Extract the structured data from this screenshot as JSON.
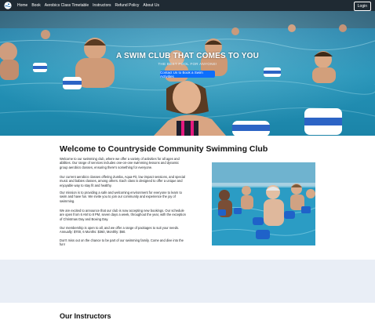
{
  "nav": {
    "items": [
      "Home",
      "Book",
      "Aerobics Class Timetable",
      "Instructors",
      "Refund Policy",
      "About Us"
    ],
    "login": "Login"
  },
  "hero": {
    "title": "A SWIM CLUB THAT COMES TO YOU",
    "subtitle": "THE BEST POOL FOR ANYONE!",
    "cta": "Contact Us to Book a Swim Activities"
  },
  "welcome": {
    "title": "Welcome to Countryside Community Swimming Club",
    "paragraphs": [
      "Welcome to our swimming club, where we offer a variety of activities for all ages and abilities. Our range of services includes one-on-one swimming lessons and dynamic group aerobics classes, ensuring there's something for everyone.",
      "Our current aerobics classes offering Zumba, Aqua-Fit, low impact sessions, and special music and babies classes, among others. Each class is designed to offer a unique and enjoyable way to stay fit and healthy.",
      "Our mission is to providing a safe and welcoming environment for everyone to learn to swim and have fun. We invite you to join our community and experience the joy of swimming.",
      "We are excited to announce that our club is now accepting new bookings. Our schedule are open from 6 AM to 8 PM, seven days a week, throughout the year, with the exception of Christmas Day and Boxing Day.",
      "Our membership is open to all, and we offer a range of packages to suit your needs. Annually: $700, 6 Months: $360, Monthly: $60.",
      "Don't miss out on the chance to be part of our swimming family. Come and dive into the fun!"
    ]
  },
  "instructors": {
    "title": "Our Instructors"
  },
  "colors": {
    "navbar": "#1f2a33",
    "primary": "#0d6efd",
    "band": "#e9eef6"
  }
}
